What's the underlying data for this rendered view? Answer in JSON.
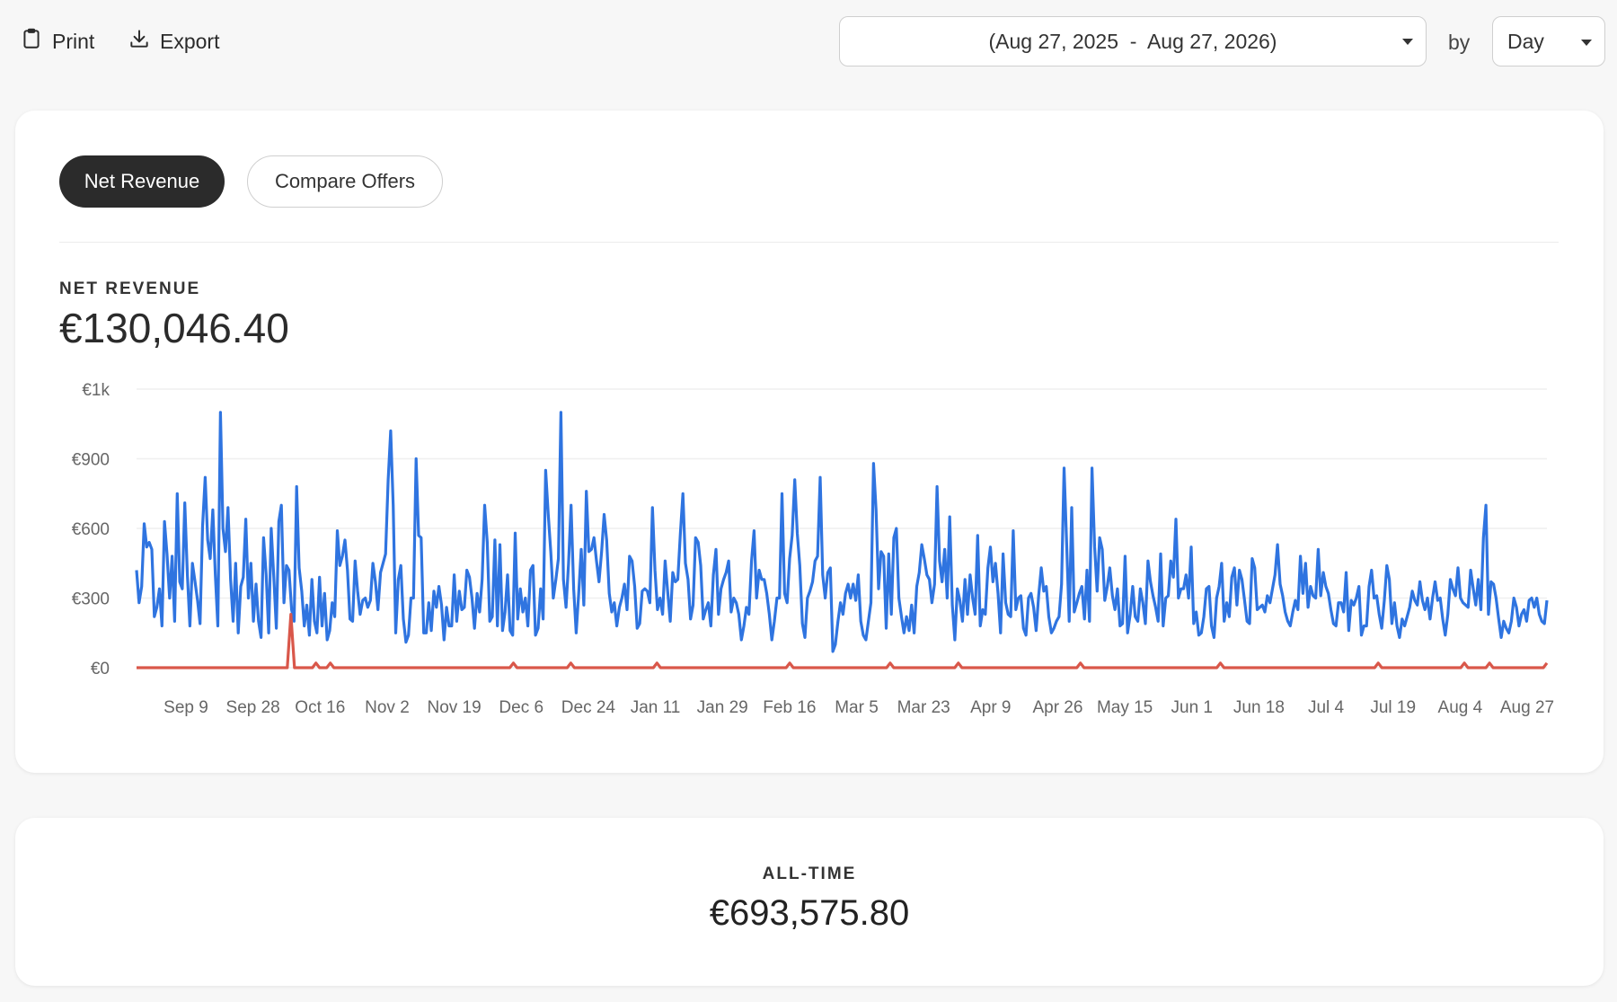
{
  "toolbar": {
    "print_label": "Print",
    "export_label": "Export",
    "date_range": "(Aug 27, 2025  -  Aug 27, 2026)",
    "by_label": "by",
    "granularity": "Day"
  },
  "tabs": [
    {
      "label": "Net Revenue",
      "active": true
    },
    {
      "label": "Compare Offers",
      "active": false
    }
  ],
  "metric": {
    "label": "NET REVENUE",
    "value": "€130,046.40"
  },
  "all_time": {
    "label": "ALL-TIME",
    "value": "€693,575.80"
  },
  "colors": {
    "series_primary": "#2f74e0",
    "series_secondary": "#d9574a",
    "active_tab": "#2b2b2b"
  },
  "chart_data": {
    "type": "line",
    "title": "",
    "xlabel": "",
    "ylabel": "",
    "ylim": [
      0,
      1200
    ],
    "y_ticks": [
      {
        "value": 0,
        "label": "€0"
      },
      {
        "value": 300,
        "label": "€300"
      },
      {
        "value": 600,
        "label": "€600"
      },
      {
        "value": 900,
        "label": "€900"
      },
      {
        "value": 1200,
        "label": "€1k"
      }
    ],
    "x_tick_labels": [
      "Sep 9",
      "Sep 28",
      "Oct 16",
      "Nov 2",
      "Nov 19",
      "Dec 6",
      "Dec 24",
      "Jan 11",
      "Jan 29",
      "Feb 16",
      "Mar 5",
      "Mar 23",
      "Apr 9",
      "Apr 26",
      "May 15",
      "Jun 1",
      "Jun 18",
      "Jul 4",
      "Jul 19",
      "Aug 4",
      "Aug 27"
    ],
    "grid": true,
    "series": [
      {
        "values": [
          420,
          280,
          350,
          620,
          520,
          540,
          510,
          220,
          260,
          340,
          180,
          630,
          490,
          300,
          480,
          200,
          750,
          370,
          340,
          710,
          400,
          180,
          450,
          370,
          290,
          190,
          610,
          820,
          550,
          470,
          680,
          400,
          180,
          1100,
          600,
          500,
          690,
          380,
          200,
          450,
          150,
          350,
          390,
          640,
          300,
          450,
          200,
          360,
          200,
          130,
          560,
          400,
          150,
          600,
          390,
          170,
          630,
          700,
          280,
          440,
          420,
          250,
          200,
          780,
          430,
          330,
          180,
          270,
          140,
          380,
          200,
          150,
          390,
          180,
          320,
          120,
          160,
          280,
          220,
          590,
          440,
          480,
          550,
          420,
          210,
          200,
          460,
          330,
          230,
          290,
          300,
          260,
          290,
          450,
          370,
          250,
          410,
          450,
          490,
          810,
          1020,
          700,
          150,
          380,
          440,
          210,
          110,
          140,
          300,
          300,
          900,
          570,
          560,
          150,
          150,
          280,
          160,
          330,
          260,
          350,
          270,
          120,
          260,
          180,
          180,
          400,
          200,
          330,
          250,
          260,
          420,
          390,
          300,
          170,
          320,
          240,
          380,
          700,
          540,
          200,
          220,
          550,
          180,
          530,
          160,
          240,
          400,
          160,
          140,
          580,
          210,
          340,
          240,
          300,
          180,
          420,
          440,
          140,
          170,
          340,
          210,
          850,
          660,
          500,
          300,
          380,
          470,
          1100,
          380,
          260,
          450,
          700,
          340,
          150,
          320,
          510,
          270,
          760,
          500,
          510,
          560,
          460,
          370,
          500,
          660,
          550,
          320,
          240,
          280,
          180,
          260,
          300,
          360,
          250,
          480,
          460,
          350,
          170,
          190,
          330,
          340,
          330,
          280,
          690,
          420,
          250,
          300,
          230,
          460,
          330,
          200,
          410,
          370,
          380,
          580,
          750,
          450,
          380,
          210,
          270,
          560,
          540,
          440,
          210,
          250,
          280,
          180,
          400,
          510,
          230,
          340,
          380,
          410,
          460,
          240,
          300,
          280,
          230,
          120,
          180,
          260,
          230,
          460,
          590,
          300,
          420,
          380,
          380,
          320,
          230,
          120,
          200,
          300,
          300,
          750,
          320,
          280,
          470,
          570,
          810,
          580,
          440,
          190,
          130,
          300,
          330,
          370,
          460,
          480,
          820,
          400,
          300,
          410,
          430,
          70,
          100,
          200,
          280,
          230,
          320,
          360,
          300,
          360,
          290,
          400,
          200,
          140,
          120,
          200,
          280,
          880,
          680,
          340,
          500,
          480,
          170,
          490,
          230,
          560,
          600,
          300,
          220,
          150,
          220,
          160,
          270,
          150,
          350,
          410,
          530,
          470,
          400,
          380,
          280,
          360,
          780,
          460,
          370,
          510,
          300,
          650,
          270,
          120,
          340,
          290,
          200,
          380,
          230,
          400,
          300,
          230,
          570,
          180,
          250,
          230,
          430,
          520,
          370,
          450,
          320,
          150,
          490,
          280,
          230,
          220,
          590,
          250,
          300,
          310,
          170,
          140,
          300,
          320,
          260,
          160,
          310,
          430,
          330,
          350,
          220,
          150,
          170,
          200,
          220,
          360,
          860,
          530,
          200,
          690,
          240,
          280,
          320,
          350,
          210,
          420,
          200,
          860,
          520,
          330,
          560,
          510,
          290,
          350,
          430,
          310,
          250,
          340,
          180,
          190,
          480,
          150,
          230,
          350,
          220,
          200,
          340,
          280,
          190,
          460,
          370,
          310,
          260,
          200,
          490,
          180,
          300,
          310,
          460,
          390,
          640,
          300,
          340,
          340,
          400,
          300,
          520,
          190,
          240,
          140,
          150,
          220,
          340,
          350,
          180,
          130,
          300,
          350,
          450,
          200,
          280,
          220,
          390,
          430,
          270,
          420,
          380,
          290,
          200,
          190,
          470,
          430,
          250,
          260,
          270,
          240,
          310,
          280,
          340,
          400,
          530,
          360,
          310,
          240,
          200,
          180,
          240,
          290,
          250,
          480,
          320,
          450,
          260,
          350,
          310,
          300,
          510,
          310,
          410,
          350,
          320,
          250,
          190,
          180,
          280,
          280,
          240,
          410,
          160,
          290,
          270,
          300,
          350,
          140,
          180,
          180,
          350,
          420,
          300,
          310,
          230,
          170,
          290,
          440,
          380,
          190,
          280,
          180,
          130,
          210,
          180,
          220,
          260,
          330,
          290,
          270,
          370,
          290,
          250,
          300,
          210,
          300,
          370,
          290,
          300,
          210,
          140,
          230,
          380,
          340,
          310,
          430,
          300,
          280,
          270,
          260,
          420,
          340,
          270,
          380,
          250,
          560,
          700,
          230,
          370,
          360,
          300,
          210,
          130,
          200,
          170,
          150,
          200,
          300,
          260,
          180,
          230,
          250,
          200,
          290,
          300,
          260,
          300,
          230,
          200,
          190,
          290
        ]
      },
      {
        "values": [
          0,
          0,
          0,
          0,
          0,
          0,
          0,
          0,
          0,
          0,
          0,
          0,
          0,
          0,
          0,
          0,
          0,
          0,
          0,
          0,
          0,
          0,
          0,
          0,
          0,
          0,
          0,
          0,
          0,
          0,
          0,
          0,
          0,
          0,
          0,
          0,
          0,
          0,
          0,
          0,
          0,
          0,
          0,
          230,
          0,
          0,
          0,
          0,
          0,
          0,
          20,
          0,
          0,
          0,
          20,
          0,
          0,
          0,
          0,
          0,
          0,
          0,
          0,
          0,
          0,
          0,
          0,
          0,
          0,
          0,
          0,
          0,
          0,
          0,
          0,
          0,
          0,
          0,
          0,
          0,
          0,
          0,
          0,
          0,
          0,
          0,
          0,
          0,
          0,
          0,
          0,
          0,
          0,
          0,
          0,
          0,
          0,
          0,
          0,
          0,
          0,
          0,
          0,
          0,
          0,
          20,
          0,
          0,
          0,
          0,
          0,
          0,
          0,
          0,
          0,
          0,
          0,
          0,
          0,
          0,
          0,
          20,
          0,
          0,
          0,
          0,
          0,
          0,
          0,
          0,
          0,
          0,
          0,
          0,
          0,
          0,
          0,
          0,
          0,
          0,
          0,
          0,
          0,
          0,
          0,
          20,
          0,
          0,
          0,
          0,
          0,
          0,
          0,
          0,
          0,
          0,
          0,
          0,
          0,
          0,
          0,
          0,
          0,
          0,
          0,
          0,
          0,
          0,
          0,
          0,
          0,
          0,
          0,
          0,
          0,
          0,
          0,
          0,
          0,
          0,
          0,
          0,
          20,
          0,
          0,
          0,
          0,
          0,
          0,
          0,
          0,
          0,
          0,
          0,
          0,
          0,
          0,
          0,
          0,
          0,
          0,
          0,
          0,
          0,
          0,
          0,
          0,
          0,
          0,
          0,
          20,
          0,
          0,
          0,
          0,
          0,
          0,
          0,
          0,
          0,
          0,
          0,
          0,
          0,
          0,
          0,
          0,
          0,
          0,
          20,
          0,
          0,
          0,
          0,
          0,
          0,
          0,
          0,
          0,
          0,
          0,
          0,
          0,
          0,
          0,
          0,
          0,
          0,
          0,
          0,
          0,
          0,
          0,
          0,
          0,
          0,
          0,
          0,
          0,
          0,
          0,
          0,
          0,
          20,
          0,
          0,
          0,
          0,
          0,
          0,
          0,
          0,
          0,
          0,
          0,
          0,
          0,
          0,
          0,
          0,
          0,
          0,
          0,
          0,
          0,
          0,
          0,
          0,
          0,
          0,
          0,
          0,
          0,
          0,
          0,
          0,
          0,
          0,
          0,
          0,
          0,
          0,
          20,
          0,
          0,
          0,
          0,
          0,
          0,
          0,
          0,
          0,
          0,
          0,
          0,
          0,
          0,
          0,
          0,
          0,
          0,
          0,
          0,
          0,
          0,
          0,
          0,
          0,
          0,
          0,
          0,
          0,
          0,
          0,
          0,
          0,
          0,
          0,
          0,
          0,
          0,
          0,
          0,
          0,
          0,
          0,
          20,
          0,
          0,
          0,
          0,
          0,
          0,
          0,
          0,
          0,
          0,
          0,
          0,
          0,
          0,
          0,
          0,
          0,
          0,
          0,
          0,
          0,
          0,
          0,
          20,
          0,
          0,
          0,
          0,
          0,
          0,
          20,
          0,
          0,
          0,
          0,
          0,
          0,
          0,
          0,
          0,
          0,
          0,
          0,
          0,
          0,
          0,
          20
        ]
      }
    ]
  }
}
